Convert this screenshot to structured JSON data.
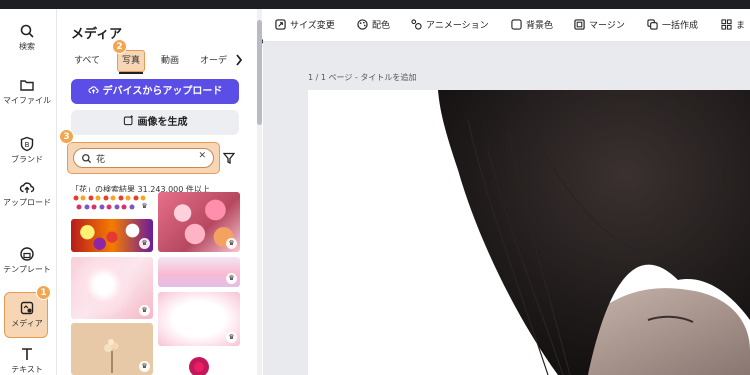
{
  "rail": {
    "items": [
      {
        "label": "検索"
      },
      {
        "label": "マイファイル"
      },
      {
        "label": "ブランド"
      },
      {
        "label": "アップロード"
      },
      {
        "label": "テンプレート"
      },
      {
        "label": "メディア"
      },
      {
        "label": "テキスト"
      }
    ]
  },
  "badges": {
    "one": "1",
    "two": "2",
    "three": "3"
  },
  "panel": {
    "title": "メディア",
    "tabs": [
      "すべて",
      "写真",
      "動画",
      "オーデ"
    ],
    "upload_button": "デバイスからアップロード",
    "generate_button": "画像を生成",
    "search_value": "花",
    "result_count": "「花」の検索結果 31,243,000 件以上"
  },
  "toolbar": {
    "items": [
      "サイズ変更",
      "配色",
      "アニメーション",
      "背景色",
      "マージン",
      "一括作成",
      "ま"
    ]
  },
  "canvas": {
    "page_label": "1 / 1 ページ - タイトルを追加"
  },
  "colors": {
    "primary": "#5b4ee6",
    "highlight": "#f6d6b4",
    "badge": "#f3a550"
  }
}
